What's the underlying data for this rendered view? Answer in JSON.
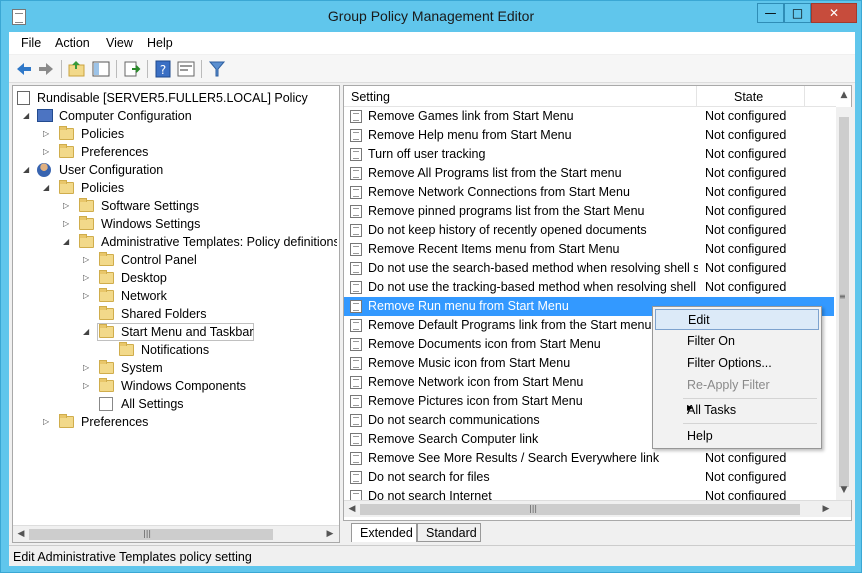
{
  "window": {
    "title": "Group Policy Management Editor"
  },
  "menubar": {
    "items": [
      "File",
      "Action",
      "View",
      "Help"
    ]
  },
  "toolbar": {
    "icons": [
      "back-icon",
      "forward-icon",
      "up-folder-icon",
      "show-hide-tree-icon",
      "export-list-icon",
      "help-icon",
      "properties-icon",
      "filter-icon"
    ]
  },
  "tree": {
    "root": "Rundisable [SERVER5.FULLER5.LOCAL] Policy",
    "computer_config": "Computer Configuration",
    "cc_policies": "Policies",
    "cc_preferences": "Preferences",
    "user_config": "User Configuration",
    "uc_policies": "Policies",
    "software_settings": "Software Settings",
    "windows_settings": "Windows Settings",
    "admin_templates": "Administrative Templates: Policy definitions (A",
    "control_panel": "Control Panel",
    "desktop": "Desktop",
    "network": "Network",
    "shared_folders": "Shared Folders",
    "start_menu": "Start Menu and Taskbar",
    "notifications": "Notifications",
    "system": "System",
    "windows_components": "Windows Components",
    "all_settings": "All Settings",
    "uc_preferences": "Preferences"
  },
  "list": {
    "col_setting": "Setting",
    "col_state": "State",
    "rows": [
      {
        "name": "Remove Games link from Start Menu",
        "state": "Not configured"
      },
      {
        "name": "Remove Help menu from Start Menu",
        "state": "Not configured"
      },
      {
        "name": "Turn off user tracking",
        "state": "Not configured"
      },
      {
        "name": "Remove All Programs list from the Start menu",
        "state": "Not configured"
      },
      {
        "name": "Remove Network Connections from Start Menu",
        "state": "Not configured"
      },
      {
        "name": "Remove pinned programs list from the Start Menu",
        "state": "Not configured"
      },
      {
        "name": "Do not keep history of recently opened documents",
        "state": "Not configured"
      },
      {
        "name": "Remove Recent Items menu from Start Menu",
        "state": "Not configured"
      },
      {
        "name": "Do not use the search-based method when resolving shell s...",
        "state": "Not configured"
      },
      {
        "name": "Do not use the tracking-based method when resolving shell ...",
        "state": "Not configured"
      },
      {
        "name": "Remove Run menu from Start Menu",
        "state": ""
      },
      {
        "name": "Remove Default Programs link from the Start menu.",
        "state": ""
      },
      {
        "name": "Remove Documents icon from Start Menu",
        "state": ""
      },
      {
        "name": "Remove Music icon from Start Menu",
        "state": ""
      },
      {
        "name": "Remove Network icon from Start Menu",
        "state": ""
      },
      {
        "name": "Remove Pictures icon from Start Menu",
        "state": ""
      },
      {
        "name": "Do not search communications",
        "state": ""
      },
      {
        "name": "Remove Search Computer link",
        "state": ""
      },
      {
        "name": "Remove See More Results / Search Everywhere link",
        "state": "Not configured"
      },
      {
        "name": "Do not search for files",
        "state": "Not configured"
      },
      {
        "name": "Do not search Internet",
        "state": "Not configured"
      }
    ]
  },
  "context_menu": {
    "edit": "Edit",
    "filter_on": "Filter On",
    "filter_options": "Filter Options...",
    "reapply_filter": "Re-Apply Filter",
    "all_tasks": "All Tasks",
    "help": "Help"
  },
  "tabs": {
    "extended": "Extended",
    "standard": "Standard"
  },
  "status": {
    "text": "Edit Administrative Templates policy setting"
  }
}
